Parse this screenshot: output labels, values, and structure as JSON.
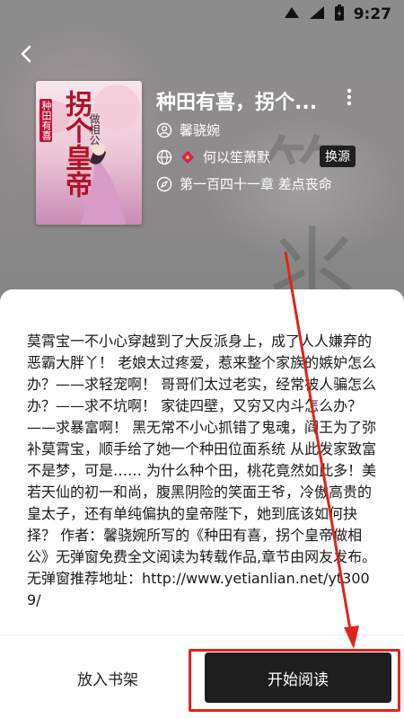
{
  "status_bar": {
    "time": "9:27",
    "battery_icon": "battery-charging-icon",
    "wifi_icon": "wifi-icon",
    "signal_icon": "signal-icon"
  },
  "book": {
    "title": "种田有喜，拐个...",
    "author": "馨骁婉",
    "source": "何以笙萧默",
    "source_switch_label": "换源",
    "latest_chapter": "第一百四十一章 差点丧命",
    "cover_text_main": "拐个皇帝",
    "cover_text_sub": "种田有喜",
    "cover_text_side": "做相公"
  },
  "intro": "莫霄宝一不小心穿越到了大反派身上，成了人人嫌弃的恶霸大胖丫！ 老娘太过疼爱，惹来整个家族的嫉妒怎么办？——求轻宠啊！ 哥哥们太过老实，经常被人骗怎么办？——求不坑啊！ 家徒四壁，又穷又内斗怎么办？——求暴富啊！ 黑无常不小心抓错了鬼魂，阎王为了弥补莫霄宝，顺手给了她一个种田位面系统 从此发家致富不是梦，可是…… 为什么种个田，桃花竟然如此多！美若天仙的初一和尚，腹黑阴险的笑面王爷，冷傲高贵的皇太子，还有单纯偏执的皇帝陛下，她到底该如何抉择？ 作者：馨骁婉所写的《种田有喜，拐个皇帝做相公》无弹窗免费全文阅读为转载作品,章节由网友发布。 无弹窗推荐地址：http://www.yetianlian.net/yt3009/",
  "actions": {
    "add_to_shelf": "放入书架",
    "start_reading": "开始阅读"
  },
  "colors": {
    "annotation": "#e0241b",
    "primary_button": "#1e1e1e"
  }
}
